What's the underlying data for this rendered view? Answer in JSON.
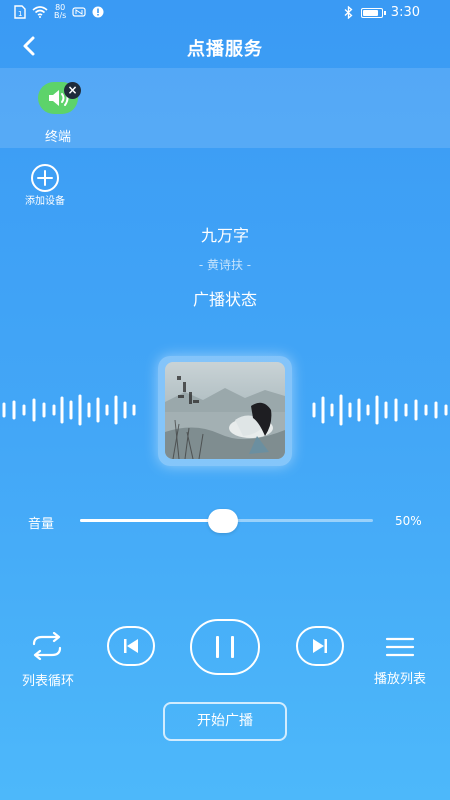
{
  "status_bar": {
    "sim_icon": "sim-card-icon",
    "wifi_icon": "wifi-icon",
    "net_speed": "80",
    "net_speed_unit": "B/s",
    "nfc_icon": "nfc-icon",
    "notification_icon": "notification-icon",
    "bluetooth_icon": "bluetooth-icon",
    "battery_level": 0.9,
    "time": "3:30"
  },
  "header": {
    "back_icon": "chevron-left-icon",
    "title": "点播服务"
  },
  "devices": {
    "items": [
      {
        "label": "终端",
        "icon": "speaker-icon",
        "remove_icon": "close-icon"
      }
    ],
    "add_label": "添加设备",
    "add_icon": "plus-circle-icon"
  },
  "now_playing": {
    "title": "九万字",
    "artist": "- 黄诗扶 -",
    "status": "广播状态",
    "cover_icon": "album-cover-image"
  },
  "volume": {
    "label": "音量",
    "value": 0.5,
    "percent_text": "50%"
  },
  "controls": {
    "loop_label": "列表循环",
    "loop_icon": "repeat-icon",
    "prev_icon": "skip-previous-icon",
    "pause_icon": "pause-icon",
    "next_icon": "skip-next-icon",
    "playlist_label": "播放列表",
    "playlist_icon": "menu-icon"
  },
  "start_button": "开始广播",
  "colors": {
    "background_top": "#3a9af4",
    "background_bottom": "#4db8fa",
    "terminal_badge": "#5dd36a",
    "remove_badge": "#1f2b3a"
  }
}
